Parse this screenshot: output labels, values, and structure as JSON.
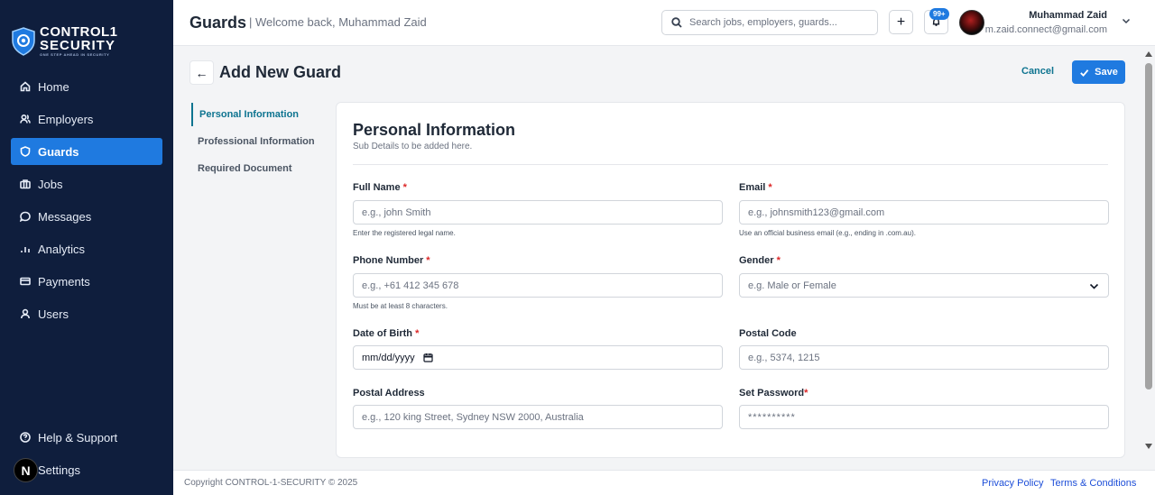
{
  "brand": {
    "line1": "CONTROL1",
    "line2": "SECURITY",
    "tagline": "ONE STEP AHEAD IN SECURITY"
  },
  "sidebar": {
    "items": [
      {
        "label": "Home",
        "icon": "home-icon"
      },
      {
        "label": "Employers",
        "icon": "users-icon"
      },
      {
        "label": "Guards",
        "icon": "shield-icon",
        "active": true
      },
      {
        "label": "Jobs",
        "icon": "briefcase-icon"
      },
      {
        "label": "Messages",
        "icon": "message-icon"
      },
      {
        "label": "Analytics",
        "icon": "bar-chart-icon"
      },
      {
        "label": "Payments",
        "icon": "credit-card-icon"
      },
      {
        "label": "Users",
        "icon": "user-icon"
      }
    ],
    "bottom": [
      {
        "label": "Help & Support",
        "icon": "help-circle-icon"
      },
      {
        "label": "Settings",
        "icon": "gear-icon"
      }
    ],
    "badge_letter": "N"
  },
  "header": {
    "title": "Guards",
    "welcome": "| Welcome back, Muhammad Zaid",
    "search_placeholder": "Search jobs, employers, guards...",
    "add_label": "+",
    "notifications": "99+",
    "user_name": "Muhammad Zaid",
    "user_email": "m.zaid.connect@gmail.com"
  },
  "page": {
    "back_label": "←",
    "title": "Add New Guard",
    "cancel_label": "Cancel",
    "save_label": "Save"
  },
  "steps": [
    {
      "label": "Personal Information",
      "active": true
    },
    {
      "label": "Professional Information"
    },
    {
      "label": "Required Document"
    }
  ],
  "form": {
    "title": "Personal Information",
    "subtitle": "Sub Details to be added here.",
    "required_mark": "*",
    "full_name": {
      "label": "Full Name",
      "placeholder": "e.g., john Smith",
      "help": "Enter the registered legal name."
    },
    "email": {
      "label": "Email",
      "placeholder": "e.g., johnsmith123@gmail.com",
      "help": "Use an official business email (e.g., ending in .com.au)."
    },
    "phone": {
      "label": "Phone Number",
      "placeholder": "e.g., +61 412 345 678",
      "help": "Must be at least 8 characters."
    },
    "gender": {
      "label": "Gender",
      "placeholder": "e.g. Male or Female"
    },
    "dob": {
      "label": "Date of Birth",
      "value": "mm/dd/yyyy"
    },
    "postal_code": {
      "label": "Postal Code",
      "placeholder": "e.g., 5374, 1215"
    },
    "postal_address": {
      "label": "Postal Address",
      "placeholder": "e.g., 120 king Street, Sydney NSW 2000, Australia"
    },
    "password": {
      "label": "Set Password",
      "value": "**********"
    }
  },
  "footer": {
    "copyright": "Copyright CONTROL-1-SECURITY © 2025",
    "privacy": "Privacy Policy",
    "terms": "Terms & Conditions"
  },
  "colors": {
    "sidebar_bg": "#0f1e3d",
    "accent": "#1f7ae0",
    "teal": "#0e7490",
    "required": "#dc2626"
  }
}
